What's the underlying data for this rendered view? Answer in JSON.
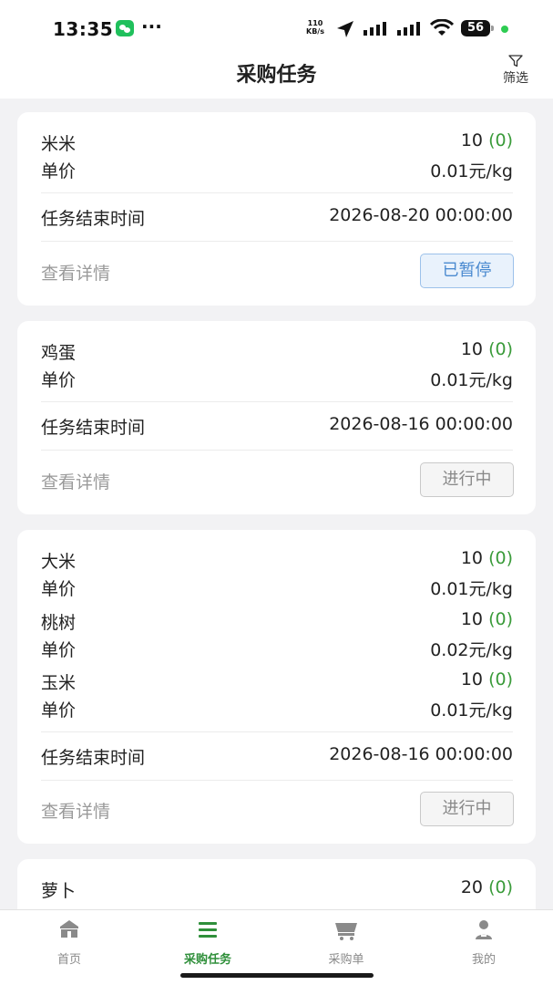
{
  "status_bar": {
    "time": "13:35",
    "more": "···",
    "net_speed_value": "110",
    "net_speed_unit": "KB/s",
    "battery": "56"
  },
  "header": {
    "title": "采购任务",
    "filter_label": "筛选"
  },
  "labels": {
    "unit_price": "单价",
    "end_time": "任务结束时间",
    "view_detail": "查看详情"
  },
  "tasks": [
    {
      "items": [
        {
          "name": "米米",
          "qty": "10",
          "qty_extra": "(0)",
          "price": "0.01元/kg"
        }
      ],
      "end_time": "2026-08-20 00:00:00",
      "status": "已暂停"
    },
    {
      "items": [
        {
          "name": "鸡蛋",
          "qty": "10",
          "qty_extra": "(0)",
          "price": "0.01元/kg"
        }
      ],
      "end_time": "2026-08-16 00:00:00",
      "status": "进行中"
    },
    {
      "items": [
        {
          "name": "大米",
          "qty": "10",
          "qty_extra": "(0)",
          "price": "0.01元/kg"
        },
        {
          "name": "桃树",
          "qty": "10",
          "qty_extra": "(0)",
          "price": "0.02元/kg"
        },
        {
          "name": "玉米",
          "qty": "10",
          "qty_extra": "(0)",
          "price": "0.01元/kg"
        }
      ],
      "end_time": "2026-08-16 00:00:00",
      "status": "进行中"
    },
    {
      "items": [
        {
          "name": "萝卜",
          "qty": "20",
          "qty_extra": "(0)",
          "price": ""
        }
      ],
      "end_time": "",
      "status": ""
    }
  ],
  "tabbar": [
    {
      "label": "首页",
      "icon": "home-icon",
      "active": false
    },
    {
      "label": "采购任务",
      "icon": "list-icon",
      "active": true
    },
    {
      "label": "采购单",
      "icon": "cart-icon",
      "active": false
    },
    {
      "label": "我的",
      "icon": "user-icon",
      "active": false
    }
  ],
  "colors": {
    "accent_green": "#2f8f3a",
    "qty_green": "#3a9b3a",
    "paused_blue": "#4a8ad0",
    "background": "#f2f2f4"
  }
}
